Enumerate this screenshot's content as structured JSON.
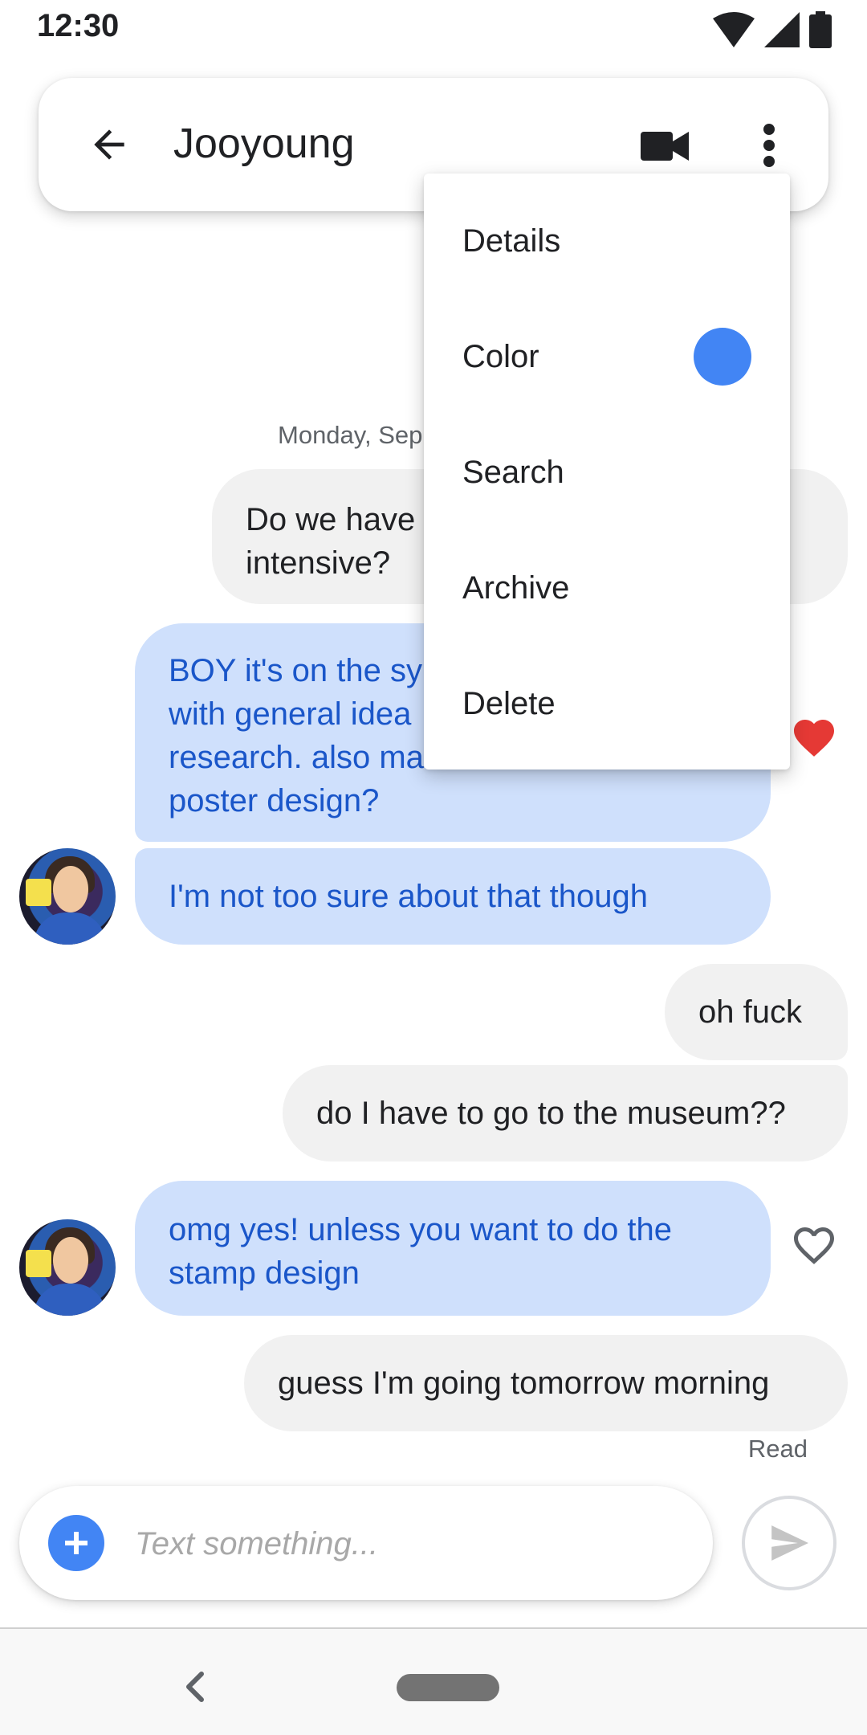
{
  "status_bar": {
    "time": "12:30",
    "icons": [
      "wifi-icon",
      "signal-icon",
      "battery-icon"
    ]
  },
  "app_bar": {
    "contact_name": "Jooyoung",
    "icons": [
      "arrow-back-icon",
      "videocam-icon",
      "more-vert-icon"
    ]
  },
  "conversation": {
    "date": "Monday, Sep",
    "messages": [
      {
        "direction": "outgoing",
        "lines": [
          "Do we have",
          "intensive?"
        ]
      },
      {
        "direction": "incoming",
        "lines": [
          "BOY it's on the sy",
          "with general idea",
          "research. also ma",
          "poster design?"
        ],
        "reaction": "heart-filled"
      },
      {
        "direction": "incoming",
        "lines": [
          "I'm not too sure about that though"
        ]
      },
      {
        "direction": "outgoing",
        "lines": [
          "oh fuck"
        ]
      },
      {
        "direction": "outgoing",
        "lines": [
          "do I have to go to the museum??"
        ]
      },
      {
        "direction": "incoming",
        "lines": [
          "omg yes! unless you want to do the",
          "stamp design"
        ],
        "reaction": "heart-outline"
      },
      {
        "direction": "outgoing",
        "lines": [
          "guess I'm going tomorrow morning"
        ]
      }
    ],
    "status": "Read"
  },
  "compose": {
    "placeholder": "Text something..."
  },
  "menu": {
    "items": [
      "Details",
      "Color",
      "Search",
      "Archive",
      "Delete"
    ],
    "color_swatch": "#4285f4"
  },
  "colors": {
    "accent": "#4285f4",
    "incoming_bubble": "#cfe0fc",
    "incoming_text": "#1a56c9",
    "outgoing_bubble": "#f1f1f1",
    "heart": "#e53935"
  }
}
